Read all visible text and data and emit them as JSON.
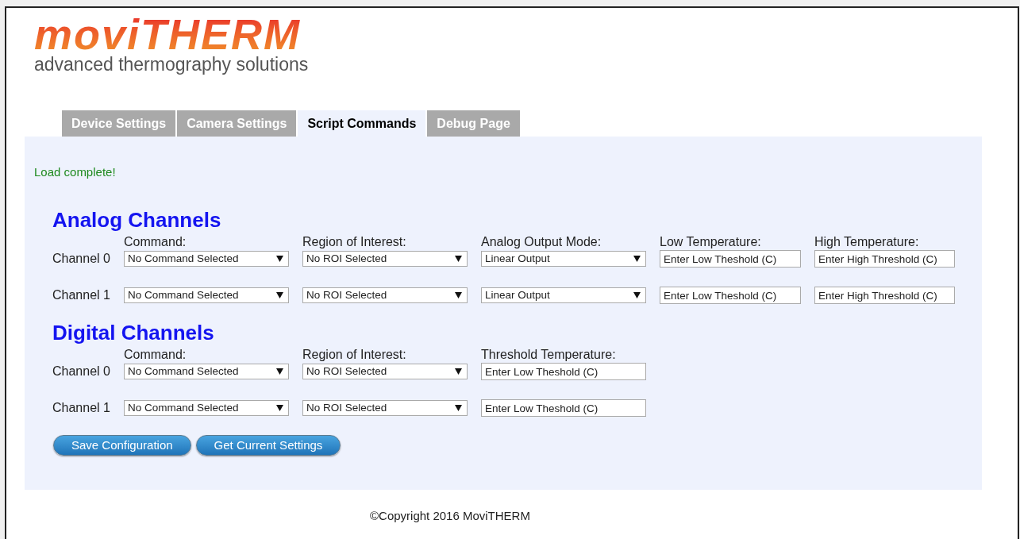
{
  "logo": {
    "wordmark": "moviTHERM",
    "tagline": "advanced thermography solutions"
  },
  "tabs": [
    {
      "label": "Device Settings",
      "selected": false
    },
    {
      "label": "Camera Settings",
      "selected": false
    },
    {
      "label": "Script Commands",
      "selected": true
    },
    {
      "label": "Debug Page",
      "selected": false
    }
  ],
  "status_message": "Load complete!",
  "sections": [
    {
      "title": "Analog Channels",
      "columns": [
        "Command:",
        "Region of Interest:",
        "Analog Output Mode:",
        "Low Temperature:",
        "High Temperature:"
      ],
      "rows": [
        {
          "label": "Channel 0",
          "controls": [
            {
              "kind": "select",
              "value": "No Command Selected"
            },
            {
              "kind": "select",
              "value": "No ROI Selected"
            },
            {
              "kind": "select",
              "value": "Linear Output"
            },
            {
              "kind": "text",
              "placeholder": "Enter Low Theshold (C)"
            },
            {
              "kind": "text",
              "placeholder": "Enter High Threshold (C)"
            }
          ]
        },
        {
          "label": "Channel 1",
          "controls": [
            {
              "kind": "select",
              "value": "No Command Selected"
            },
            {
              "kind": "select",
              "value": "No ROI Selected"
            },
            {
              "kind": "select",
              "value": "Linear Output"
            },
            {
              "kind": "text",
              "placeholder": "Enter Low Theshold (C)"
            },
            {
              "kind": "text",
              "placeholder": "Enter High Threshold (C)"
            }
          ]
        }
      ]
    },
    {
      "title": "Digital Channels",
      "columns": [
        "Command:",
        "Region of Interest:",
        "Threshold Temperature:"
      ],
      "rows": [
        {
          "label": "Channel 0",
          "controls": [
            {
              "kind": "select",
              "value": "No Command Selected"
            },
            {
              "kind": "select",
              "value": "No ROI Selected"
            },
            {
              "kind": "text",
              "placeholder": "Enter Low Theshold (C)"
            }
          ]
        },
        {
          "label": "Channel 1",
          "controls": [
            {
              "kind": "select",
              "value": "No Command Selected"
            },
            {
              "kind": "select",
              "value": "No ROI Selected"
            },
            {
              "kind": "text",
              "placeholder": "Enter Low Theshold (C)"
            }
          ]
        }
      ]
    }
  ],
  "buttons": [
    "Save Configuration",
    "Get Current Settings"
  ],
  "footer": "©Copyright 2016 MoviTHERM"
}
